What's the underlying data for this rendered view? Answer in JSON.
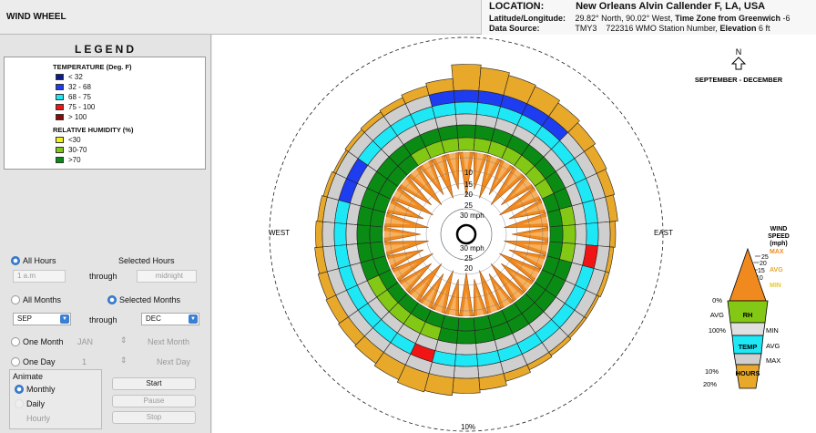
{
  "app": {
    "title": "WIND WHEEL"
  },
  "location": {
    "label": "LOCATION:",
    "name": "New Orleans Alvin Callender F, LA, USA",
    "latlon_label": "Latitude/Longitude:",
    "latlon_value": "29.82° North, 90.02° West,",
    "timezone_label": "Time Zone from Greenwich",
    "timezone_value": "-6",
    "source_label": "Data Source:",
    "source_type": "TMY3",
    "source_station": "722316 WMO Station Number,",
    "elevation_label": "Elevation",
    "elevation_value": "6 ft"
  },
  "legend": {
    "title": "LEGEND",
    "temperature_heading": "TEMPERATURE (Deg. F)",
    "temperature_items": [
      {
        "label": "< 32",
        "color": "#0b1a8c"
      },
      {
        "label": "32 - 68",
        "color": "#1e3cf0"
      },
      {
        "label": "68 - 75",
        "color": "#1ee8f5"
      },
      {
        "label": "75 - 100",
        "color": "#f01414"
      },
      {
        "label": "> 100",
        "color": "#8c0a0a"
      }
    ],
    "humidity_heading": "RELATIVE HUMIDITY (%)",
    "humidity_items": [
      {
        "label": "<30",
        "color": "#f0f01e"
      },
      {
        "label": "30-70",
        "color": "#82c814"
      },
      {
        "label": ">70",
        "color": "#0a8c14"
      }
    ]
  },
  "controls": {
    "all_hours": "All Hours",
    "selected_hours": "Selected Hours",
    "hour_from": "1 a.m",
    "through": "through",
    "hour_to": "midnight",
    "all_months": "All Months",
    "selected_months": "Selected Months",
    "month_from": "SEP",
    "month_to": "DEC",
    "one_month": "One Month",
    "one_month_value": "JAN",
    "next_month": "Next Month",
    "one_day": "One Day",
    "one_day_value": "1",
    "next_day": "Next Day",
    "animate_label": "Animate",
    "anim_monthly": "Monthly",
    "anim_daily": "Daily",
    "anim_hourly": "Hourly",
    "start": "Start",
    "pause": "Pause",
    "stop": "Stop"
  },
  "wheel": {
    "north_label": "N",
    "period": "SEPTEMBER - DECEMBER",
    "west": "WEST",
    "east": "EAST",
    "bottom_pct": "10%",
    "speed_labels_upper": [
      "10",
      "15",
      "20",
      "25",
      "30 mph"
    ],
    "speed_labels_lower": [
      "30 mph",
      "25",
      "20"
    ],
    "colors": {
      "hours": "#e8a82a",
      "temp_grey": "#cfcfcf",
      "temp_cyan": "#1ee8f5",
      "temp_blue": "#1e3cf0",
      "temp_red": "#f01414",
      "rh_dark": "#0a8c14",
      "rh_light": "#82c814",
      "wind": "#f08a1e",
      "wind_stroke": "#a05010"
    }
  },
  "key": {
    "title_line1": "WIND",
    "title_line2": "SPEED",
    "title_line3": "(mph)",
    "max": "MAX",
    "avg_top": "AVG",
    "min_top": "MIN",
    "ticks": [
      "25",
      "20",
      "15",
      "10",
      "5",
      "0"
    ],
    "rh": "RH",
    "rh_min": "0%",
    "rh_avg": "AVG",
    "rh_max": "100%",
    "min": "MIN",
    "temp": "TEMP",
    "temp_avg": "AVG",
    "temp_max": "MAX",
    "hours": "HOURS",
    "hours_min": "10%",
    "hours_max": "20%"
  }
}
